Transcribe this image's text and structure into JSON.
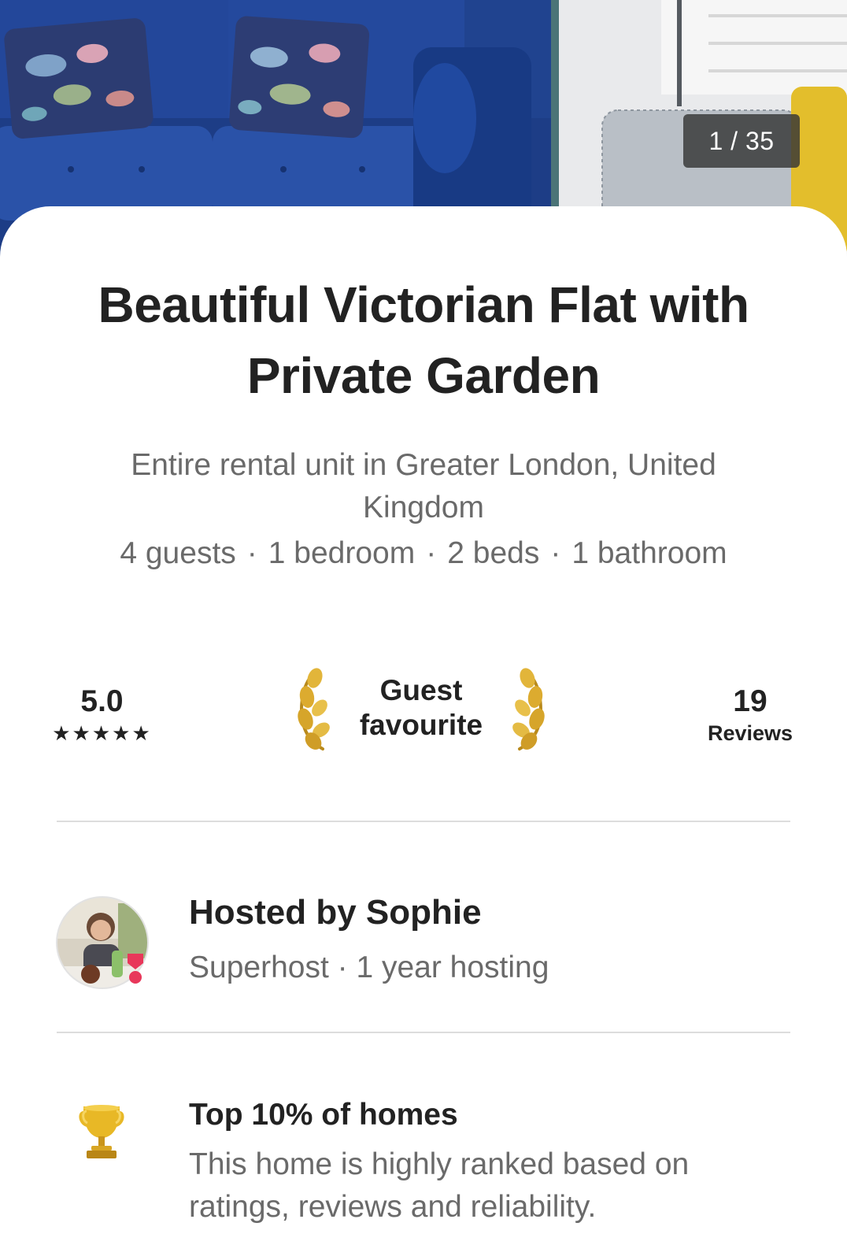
{
  "gallery": {
    "counter": "1 / 35"
  },
  "listing": {
    "title": "Beautiful Victorian Flat with Private Garden",
    "subtitle": "Entire rental unit in Greater London, United Kingdom",
    "details": [
      "4 guests",
      "1 bedroom",
      "2 beds",
      "1 bathroom"
    ],
    "separator": "·"
  },
  "stats": {
    "rating": "5.0",
    "stars": "★★★★★",
    "star_count": 5,
    "badge_line1": "Guest",
    "badge_line2": "favourite",
    "review_count": "19",
    "reviews_label": "Reviews"
  },
  "host": {
    "title": "Hosted by Sophie",
    "meta": "Superhost · 1 year hosting"
  },
  "highlight": {
    "title": "Top 10% of homes",
    "description": "This home is highly ranked based on ratings, reviews and reliability."
  },
  "colors": {
    "text_primary": "#222222",
    "text_secondary": "#6a6a6a",
    "divider": "#dddddd",
    "superhost_badge": "#e8375a",
    "gold": "#d9a92a",
    "sofa_blue": "#1e3f8c"
  },
  "icons": {
    "laurel": "laurel-icon",
    "trophy": "trophy-icon",
    "superhost": "superhost-badge-icon"
  }
}
